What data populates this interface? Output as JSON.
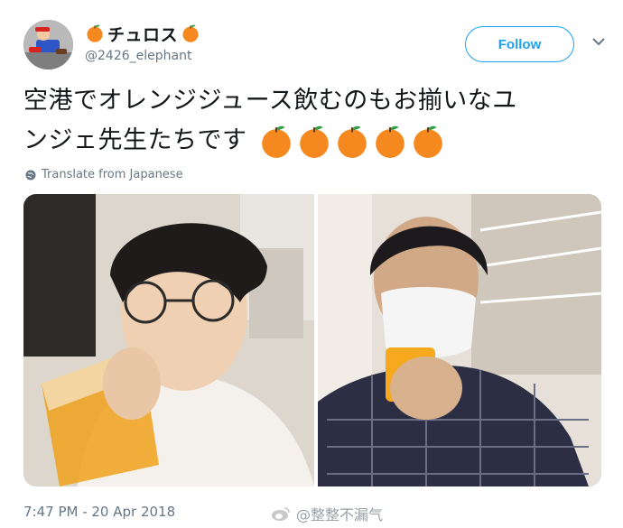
{
  "tweet": {
    "display_name": "チュロス",
    "handle": "@2426_elephant",
    "follow_label": "Follow",
    "text_line1": "空港でオレンジジュース飲むのもお揃いなユ",
    "text_line2": "ンジェ先生たちです",
    "orange_emoji_count": 5,
    "translate_label": "Translate from Japanese",
    "timestamp": "7:47 PM - 20 Apr 2018",
    "watermark": "@整整不漏气"
  },
  "icons": {
    "name_emoji": "orange-emoji",
    "caret": "chevron-down-icon",
    "translate": "globe-icon",
    "watermark": "weibo-icon"
  },
  "colors": {
    "accent": "#1da1f2",
    "secondary_text": "#657786",
    "orange": "#f5891f"
  }
}
